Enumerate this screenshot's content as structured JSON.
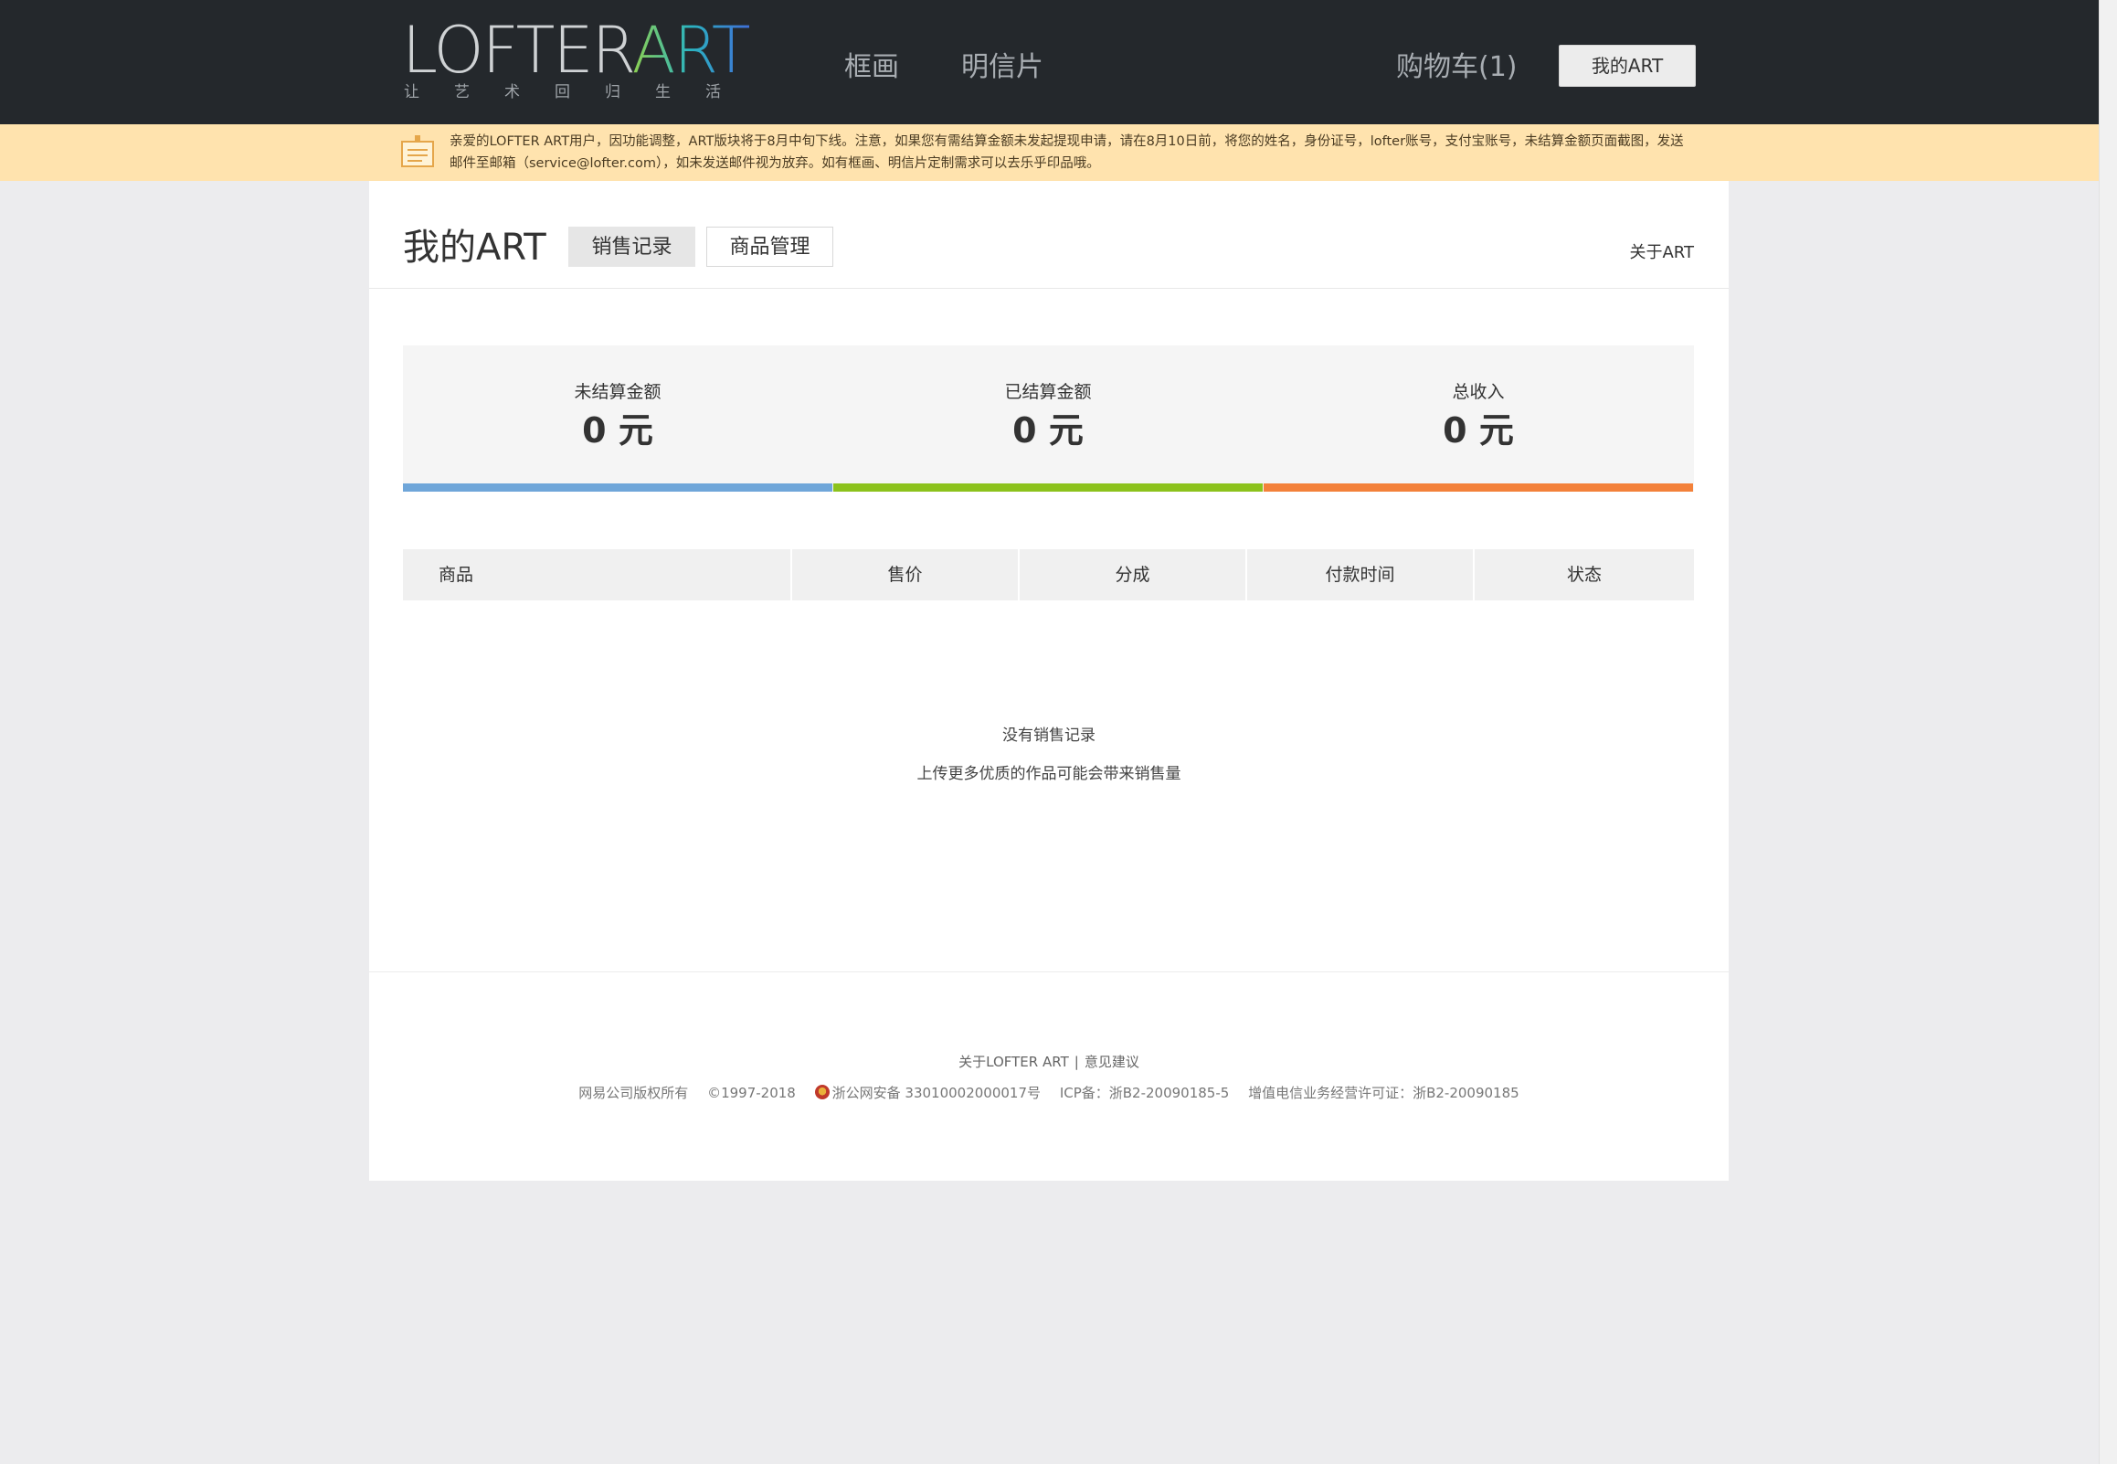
{
  "header": {
    "logo_main": "LOFTER",
    "logo_accent": "ART",
    "logo_tagline": "让艺术回归生活",
    "nav": [
      {
        "label": "框画"
      },
      {
        "label": "明信片"
      }
    ],
    "cart_label": "购物车(1)",
    "my_art_label": "我的ART"
  },
  "notice": {
    "icon": "notice-board-icon",
    "text": "亲爱的LOFTER ART用户，因功能调整，ART版块将于8月中旬下线。注意，如果您有需结算金额未发起提现申请，请在8月10日前，将您的姓名，身份证号，lofter账号，支付宝账号，未结算金额页面截图，发送邮件至邮箱（service@lofter.com），如未发送邮件视为放弃。如有框画、明信片定制需求可以去乐乎印品哦。"
  },
  "page": {
    "title": "我的ART",
    "tabs": [
      {
        "label": "销售记录",
        "active": true
      },
      {
        "label": "商品管理",
        "active": false
      }
    ],
    "about_link": "关于ART"
  },
  "stats": [
    {
      "label": "未结算金额",
      "value": "0 元",
      "color": "#6fa6d9"
    },
    {
      "label": "已结算金额",
      "value": "0 元",
      "color": "#8cc21c"
    },
    {
      "label": "总收入",
      "value": "0 元",
      "color": "#f3813a"
    }
  ],
  "table": {
    "columns": [
      "商品",
      "售价",
      "分成",
      "付款时间",
      "状态"
    ],
    "rows": []
  },
  "empty_state": {
    "title": "没有销售记录",
    "subtitle": "上传更多优质的作品可能会带来销售量"
  },
  "footer": {
    "about_link": "关于LOFTER ART",
    "separator": "|",
    "feedback_link": "意见建议",
    "copyright_owner": "网易公司版权所有",
    "copyright_years": "©1997-2018",
    "police_record": "浙公网安备 33010002000017号",
    "icp": "ICP备：浙B2-20090185-5",
    "telecom_license": "增值电信业务经营许可证：浙B2-20090185"
  }
}
